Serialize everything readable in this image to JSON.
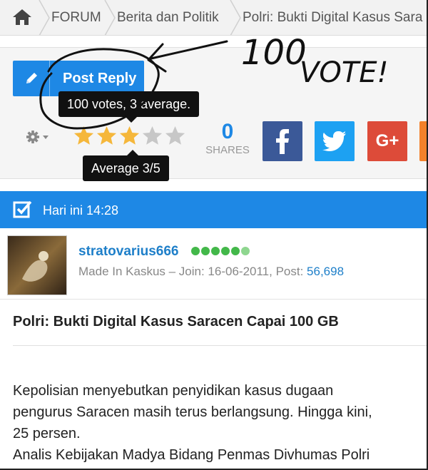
{
  "breadcrumb": {
    "items": [
      "FORUM",
      "Berita dan Politik",
      "Polri: Bukti Digital Kasus Sara"
    ]
  },
  "toolbar": {
    "reply_label": "Post Reply",
    "rating_tooltip": "100 votes, 3 average.",
    "rating_average_tooltip": "Average 3/5",
    "rating": {
      "stars_filled": 3,
      "stars_total": 5
    },
    "shares_count": "0",
    "shares_label": "SHARES",
    "social": [
      "facebook-icon",
      "twitter-icon",
      "google-plus-icon",
      "more-icon"
    ],
    "google_plus_label": "G+"
  },
  "annotation": {
    "text": "100 VOTE!",
    "part1": "100",
    "part2": "VOTE!"
  },
  "post": {
    "time": "Hari ini 14:28",
    "username": "stratovarius666",
    "reputation_dots": 6,
    "meta_prefix": "Made In Kaskus – Join: 16-06-2011, Post: ",
    "post_count": "56,698",
    "title": "Polri: Bukti Digital Kasus Saracen Capai 100 GB",
    "body_lines": [
      "Kepolisian menyebutkan penyidikan kasus dugaan",
      "pengurus Saracen masih terus berlangsung. Hingga kini,",
      "25 persen.",
      "Analis Kebijakan Madya Bidang Penmas Divhumas Polri"
    ]
  },
  "colors": {
    "accent": "#1e88e5",
    "star_filled": "#f5b73b",
    "star_empty": "#c7c7c7",
    "facebook": "#3b5998",
    "twitter": "#1da1f2",
    "google_plus": "#dd4b39",
    "reputation": "#43b84a"
  }
}
